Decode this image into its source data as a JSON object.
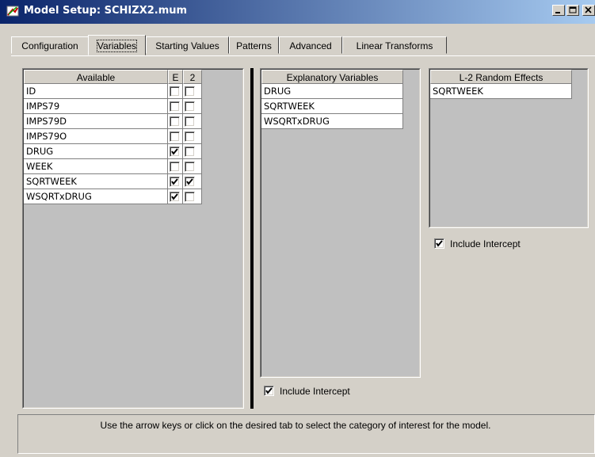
{
  "window": {
    "title": "Model Setup: SCHIZX2.mum",
    "icon": "app-icon",
    "buttons": [
      "minimize-icon",
      "maximize-icon",
      "close-icon"
    ]
  },
  "tabs": [
    {
      "label": "Configuration",
      "active": false
    },
    {
      "label": "Variables",
      "active": true
    },
    {
      "label": "Starting Values",
      "active": false
    },
    {
      "label": "Patterns",
      "active": false
    },
    {
      "label": "Advanced",
      "active": false
    },
    {
      "label": "Linear Transforms",
      "active": false
    }
  ],
  "available": {
    "headers": {
      "name": "Available",
      "e": "E",
      "two": "2"
    },
    "rows": [
      {
        "name": "ID",
        "e": false,
        "two": false
      },
      {
        "name": "IMPS79",
        "e": false,
        "two": false
      },
      {
        "name": "IMPS79D",
        "e": false,
        "two": false
      },
      {
        "name": "IMPS79O",
        "e": false,
        "two": false
      },
      {
        "name": "DRUG",
        "e": true,
        "two": false
      },
      {
        "name": "WEEK",
        "e": false,
        "two": false
      },
      {
        "name": "SQRTWEEK",
        "e": true,
        "two": true
      },
      {
        "name": "WSQRTxDRUG",
        "e": true,
        "two": false
      }
    ]
  },
  "explanatory": {
    "header": "Explanatory Variables",
    "rows": [
      "DRUG",
      "SQRTWEEK",
      "WSQRTxDRUG"
    ],
    "include_intercept": {
      "label": "Include Intercept",
      "checked": true
    }
  },
  "random_effects": {
    "header": "L-2 Random Effects",
    "rows": [
      "SQRTWEEK"
    ],
    "include_intercept": {
      "label": "Include Intercept",
      "checked": true
    }
  },
  "status_text": "Use the arrow keys or click on the desired tab to select the category of interest for the model."
}
